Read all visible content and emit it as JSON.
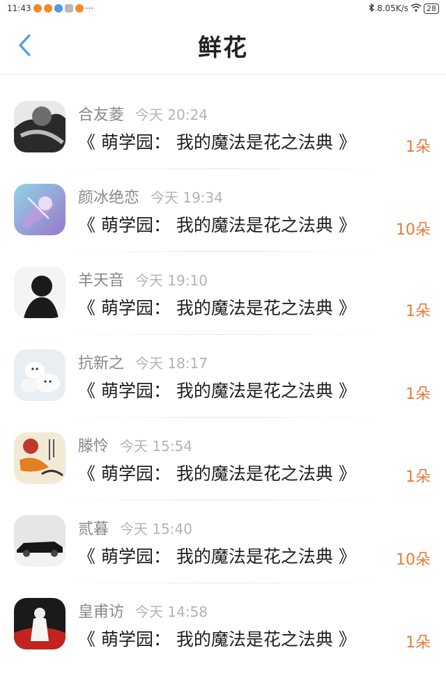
{
  "status_bar": {
    "time": "11:43",
    "dots": "···",
    "network_speed": "8.05K/s",
    "battery": "28"
  },
  "header": {
    "title": "鲜花"
  },
  "colors": {
    "accent_back": "#4a9de6",
    "count_orange": "#e87a38"
  },
  "items": [
    {
      "name": "合友菱",
      "time": "今天 20:24",
      "book": "《 萌学园： 我的魔法是花之法典 》",
      "count": "1朵",
      "avatar": "person-black-white"
    },
    {
      "name": "颜冰绝恋",
      "time": "今天 19:34",
      "book": "《 萌学园： 我的魔法是花之法典 》",
      "count": "10朵",
      "avatar": "fantasy-purple"
    },
    {
      "name": "羊天音",
      "time": "今天 19:10",
      "book": "《 萌学园： 我的魔法是花之法典 》",
      "count": "1朵",
      "avatar": "silhouette"
    },
    {
      "name": "抗新之",
      "time": "今天 18:17",
      "book": "《 萌学园： 我的魔法是花之法典 》",
      "count": "1朵",
      "avatar": "polar-bears"
    },
    {
      "name": "滕怜",
      "time": "今天 15:54",
      "book": "《 萌学园： 我的魔法是花之法典 》",
      "count": "1朵",
      "avatar": "koi-fortune"
    },
    {
      "name": "贰暮",
      "time": "今天 15:40",
      "book": "《 萌学园： 我的魔法是花之法典 》",
      "count": "10朵",
      "avatar": "black-car"
    },
    {
      "name": "皇甫访",
      "time": "今天 14:58",
      "book": "《 萌学园： 我的魔法是花之法典 》",
      "count": "1朵",
      "avatar": "red-flowers-figure"
    }
  ]
}
